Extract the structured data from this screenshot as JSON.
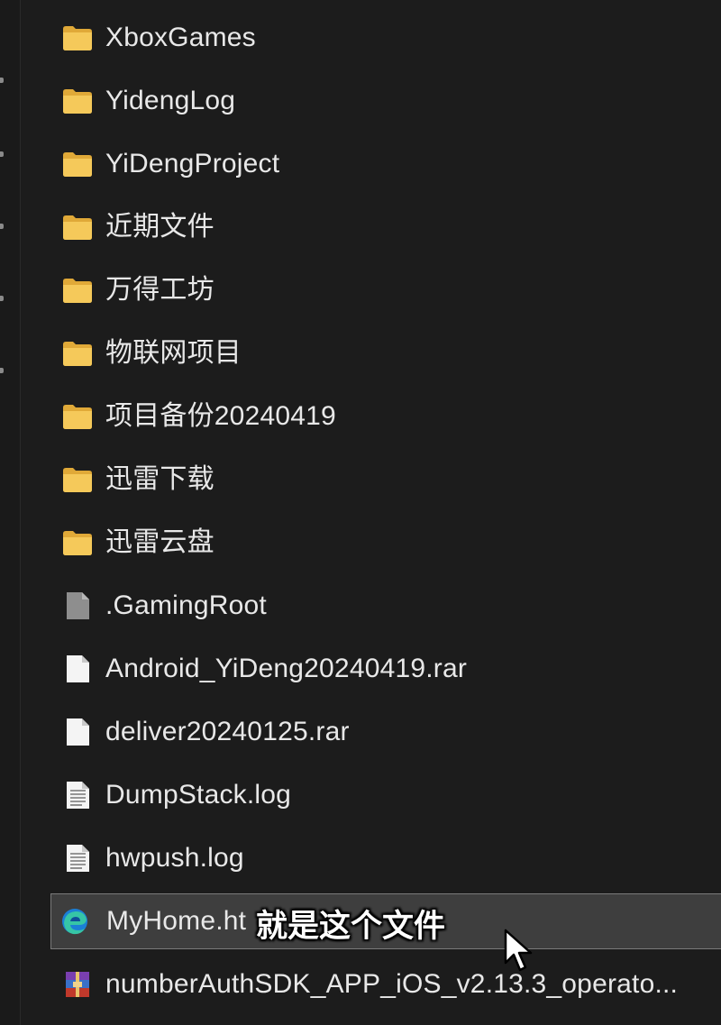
{
  "files": [
    {
      "name": "XboxGames",
      "type": "folder",
      "icon": "folder-icon"
    },
    {
      "name": "YidengLog",
      "type": "folder",
      "icon": "folder-icon"
    },
    {
      "name": "YiDengProject",
      "type": "folder",
      "icon": "folder-icon"
    },
    {
      "name": "近期文件",
      "type": "folder",
      "icon": "folder-icon"
    },
    {
      "name": "万得工坊",
      "type": "folder",
      "icon": "folder-icon"
    },
    {
      "name": "物联网项目",
      "type": "folder",
      "icon": "folder-icon"
    },
    {
      "name": "项目备份20240419",
      "type": "folder",
      "icon": "folder-icon"
    },
    {
      "name": "迅雷下载",
      "type": "folder",
      "icon": "folder-icon"
    },
    {
      "name": "迅雷云盘",
      "type": "folder",
      "icon": "folder-icon"
    },
    {
      "name": ".GamingRoot",
      "type": "system-file",
      "icon": "gray-file-icon"
    },
    {
      "name": "Android_YiDeng20240419.rar",
      "type": "file",
      "icon": "blank-file-icon"
    },
    {
      "name": "deliver20240125.rar",
      "type": "file",
      "icon": "blank-file-icon"
    },
    {
      "name": "DumpStack.log",
      "type": "text-file",
      "icon": "text-file-icon"
    },
    {
      "name": "hwpush.log",
      "type": "text-file",
      "icon": "text-file-icon"
    },
    {
      "name": "MyHome.ht",
      "type": "html",
      "icon": "edge-icon",
      "selected": true
    },
    {
      "name": "numberAuthSDK_APP_iOS_v2.13.3_operato...",
      "type": "archive",
      "icon": "winrar-icon"
    }
  ],
  "subtitle": "就是这个文件",
  "colors": {
    "background": "#1c1c1c",
    "selected_row": "#3e3e3e",
    "folder": "#f2c14e",
    "text": "#e8e8e8"
  }
}
